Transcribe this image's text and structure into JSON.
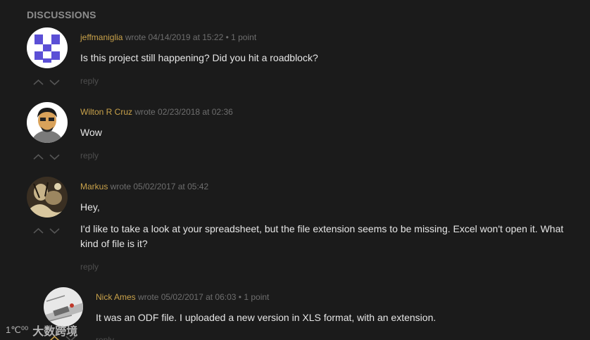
{
  "section": {
    "title": "DISCUSSIONS"
  },
  "comments": [
    {
      "author": "jeffmaniglia",
      "meta": " wrote 04/14/2019 at 15:22 • 1 point",
      "body": [
        "Is this project still happening? Did you hit a roadblock?"
      ],
      "reply_label": "reply",
      "avatar": "pixel-identicon"
    },
    {
      "author": "Wilton R Cruz",
      "meta": " wrote 02/23/2018 at 02:36",
      "body": [
        "Wow"
      ],
      "reply_label": "reply",
      "avatar": "cartoon-face"
    },
    {
      "author": "Markus",
      "meta": " wrote 05/02/2017 at 05:42",
      "body": [
        "Hey,",
        "I'd like to take a look at your spreadsheet, but the file extension seems to be missing. Excel won't open it. What kind of file is it?"
      ],
      "reply_label": "reply",
      "avatar": "sepia-photo"
    },
    {
      "author": "Nick Ames",
      "meta": " wrote 05/02/2017 at 06:03 • 1 point",
      "body": [
        "It was an ODF file. I uploaded a new version in XLS format, with an extension."
      ],
      "reply_label": "reply",
      "avatar": "circuit-photo"
    }
  ],
  "watermark": {
    "logo": "1℃⁰⁰",
    "text": "大数跨境"
  },
  "colors": {
    "background": "#1b1b1b",
    "author": "#c9a24a",
    "meta": "#6e6e6e",
    "body": "#e6e6e6",
    "reply": "#4e4e4e",
    "identicon": "#5b4fd6"
  }
}
